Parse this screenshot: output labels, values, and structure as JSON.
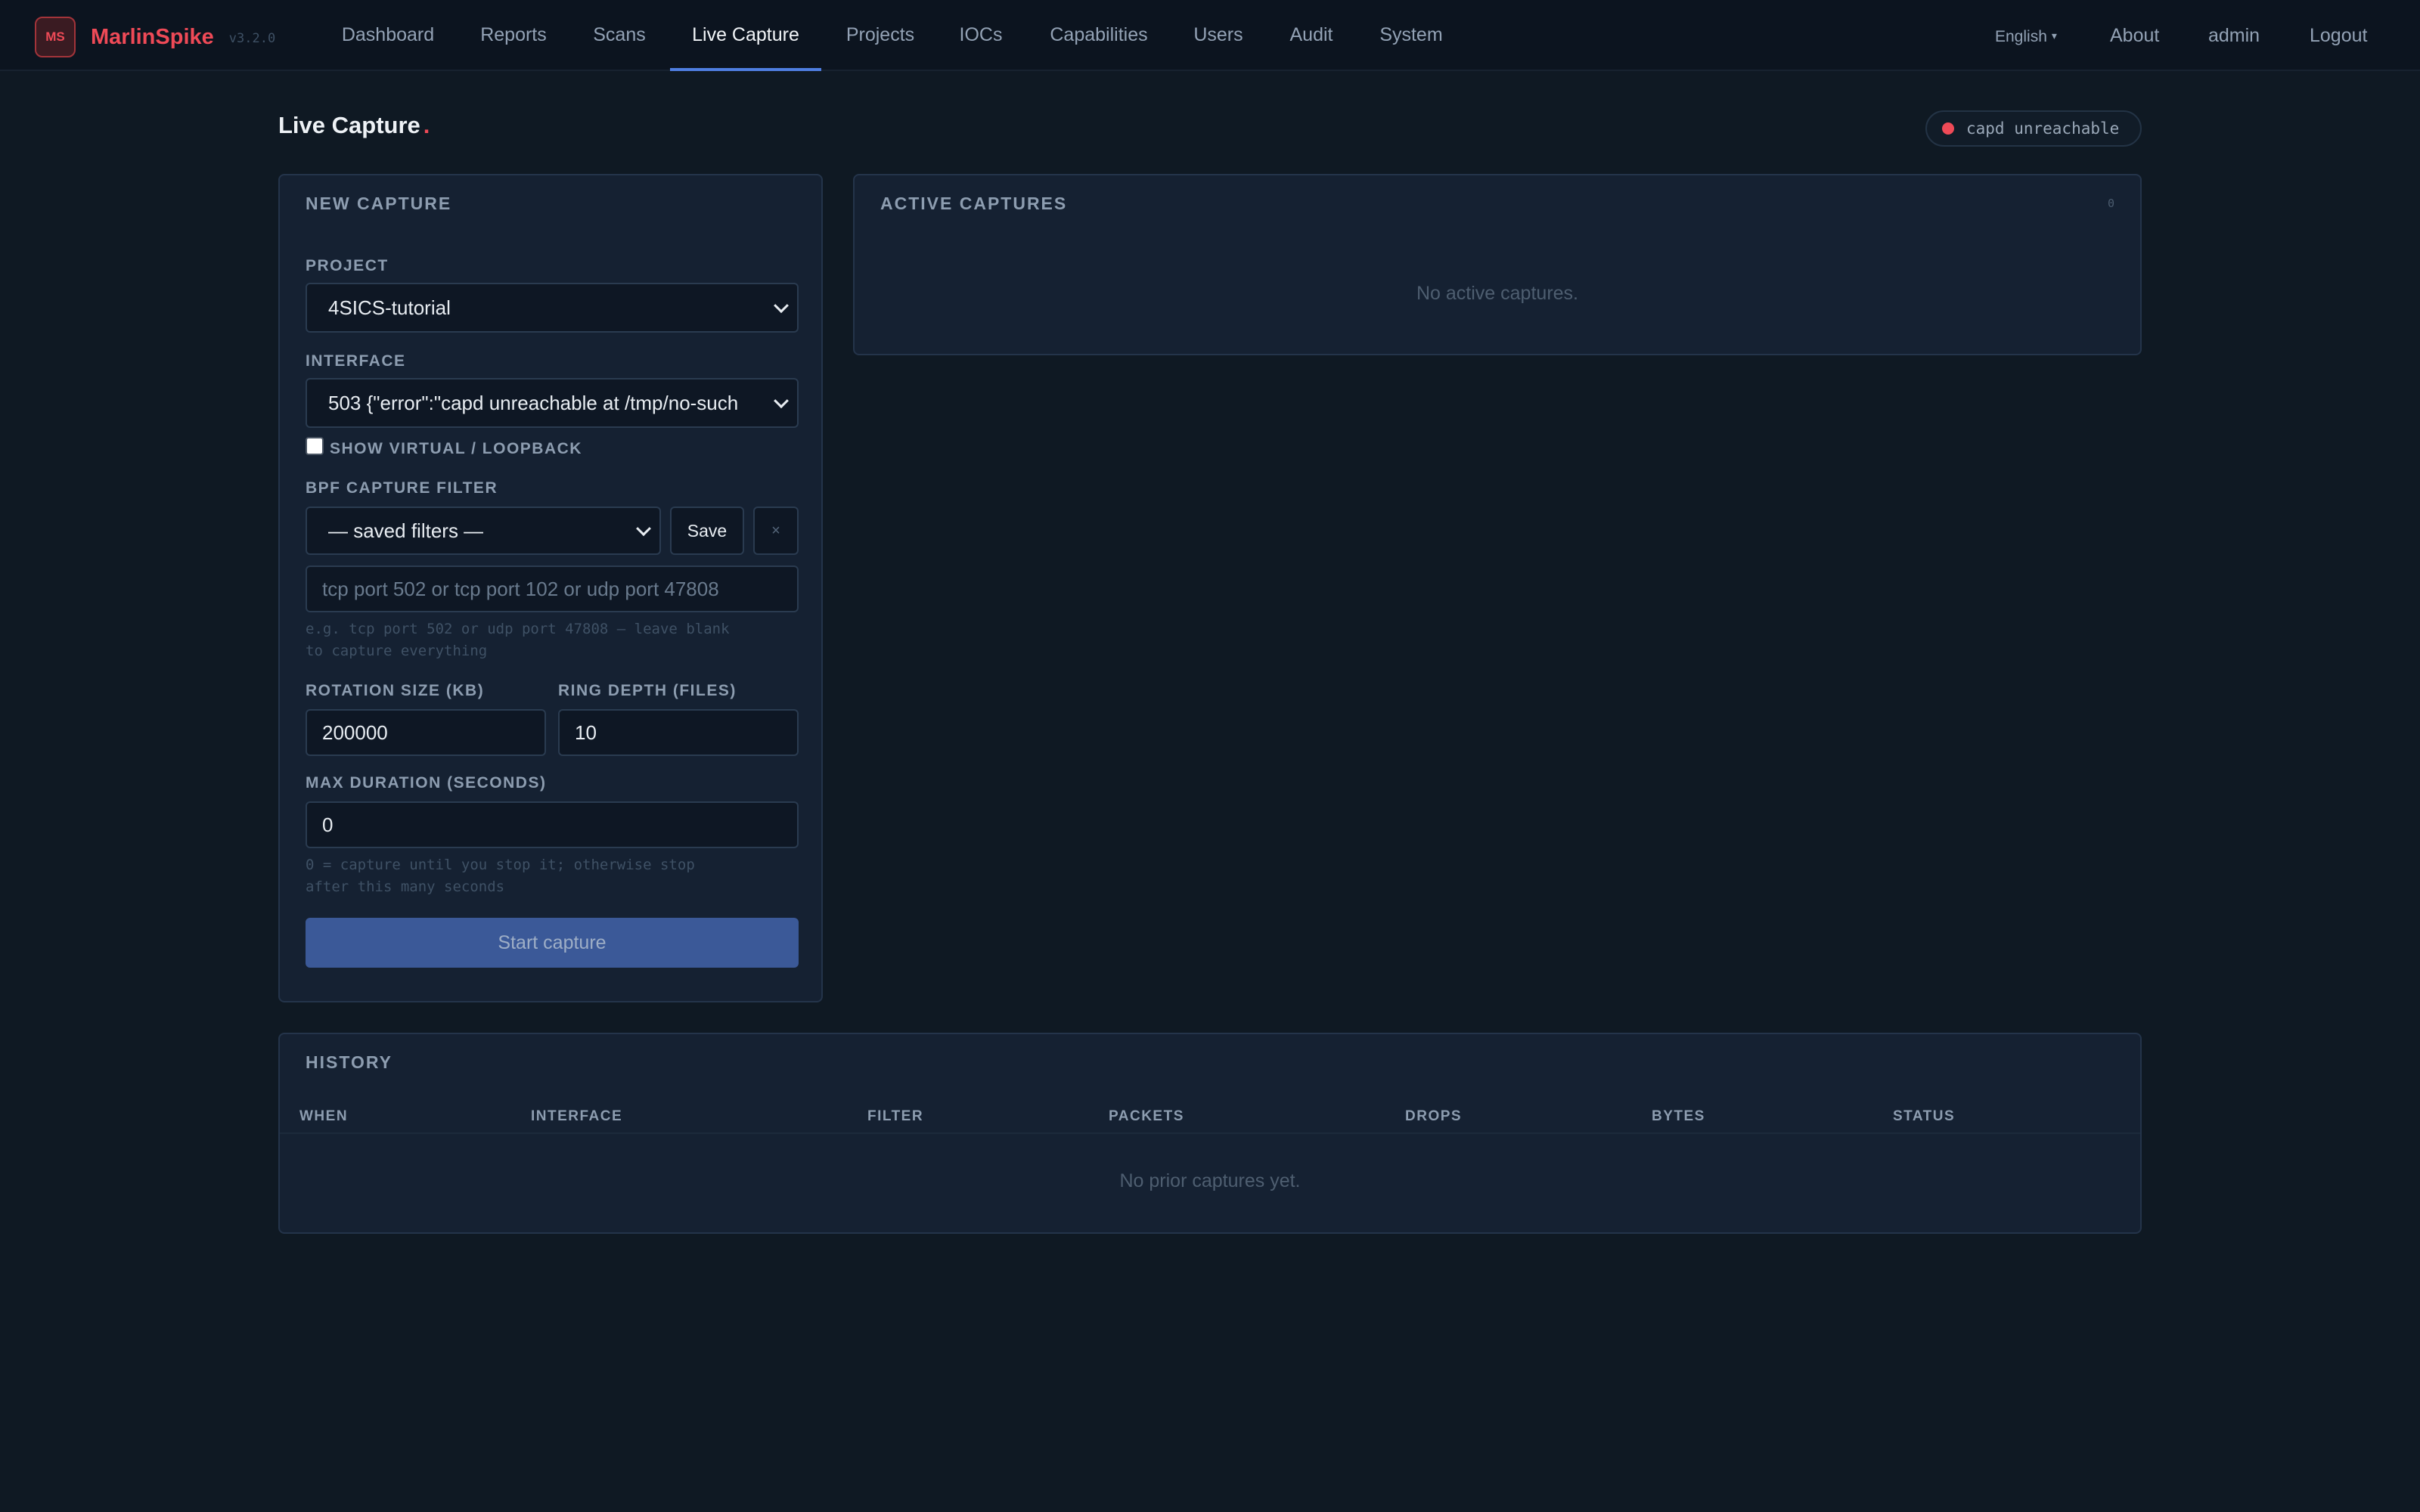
{
  "app": {
    "name": "MarlinSpike",
    "logo_text": "MS",
    "version": "v3.2.0"
  },
  "nav": {
    "items": [
      {
        "label": "Dashboard"
      },
      {
        "label": "Reports"
      },
      {
        "label": "Scans"
      },
      {
        "label": "Live Capture",
        "active": true
      },
      {
        "label": "Projects"
      },
      {
        "label": "IOCs"
      },
      {
        "label": "Capabilities"
      },
      {
        "label": "Users"
      },
      {
        "label": "Audit"
      },
      {
        "label": "System"
      }
    ],
    "language": "English",
    "about": "About",
    "user": "admin",
    "logout": "Logout"
  },
  "page": {
    "title": "Live Capture",
    "title_dot": ".",
    "status_text": "capd unreachable",
    "status_color": "#ef4a57"
  },
  "new_capture": {
    "title": "NEW CAPTURE",
    "project_label": "PROJECT",
    "project_value": "4SICS-tutorial",
    "interface_label": "INTERFACE",
    "interface_value": "503 {\"error\":\"capd unreachable at /tmp/no-such",
    "show_virtual_label": "SHOW VIRTUAL / LOOPBACK",
    "show_virtual_checked": false,
    "bpf_label": "BPF CAPTURE FILTER",
    "saved_filters_value": "— saved filters —",
    "save_label": "Save",
    "clear_label": "×",
    "filter_placeholder": "tcp port 502 or tcp port 102 or udp port 47808",
    "filter_hint_1": "e.g. tcp port 502 or udp port 47808 — leave blank",
    "filter_hint_2": "to capture everything",
    "rotation_label": "ROTATION SIZE (KB)",
    "rotation_value": "200000",
    "ring_label": "RING DEPTH (FILES)",
    "ring_value": "10",
    "duration_label": "MAX DURATION (SECONDS)",
    "duration_value": "0",
    "duration_hint_1": "0 = capture until you stop it; otherwise stop",
    "duration_hint_2": "after this many seconds",
    "start_label": "Start capture"
  },
  "active_captures": {
    "title": "ACTIVE CAPTURES",
    "count": "0",
    "empty_text": "No active captures."
  },
  "history": {
    "title": "HISTORY",
    "columns": [
      "WHEN",
      "INTERFACE",
      "FILTER",
      "PACKETS",
      "DROPS",
      "BYTES",
      "STATUS"
    ],
    "rows": [],
    "empty_text": "No prior captures yet."
  }
}
